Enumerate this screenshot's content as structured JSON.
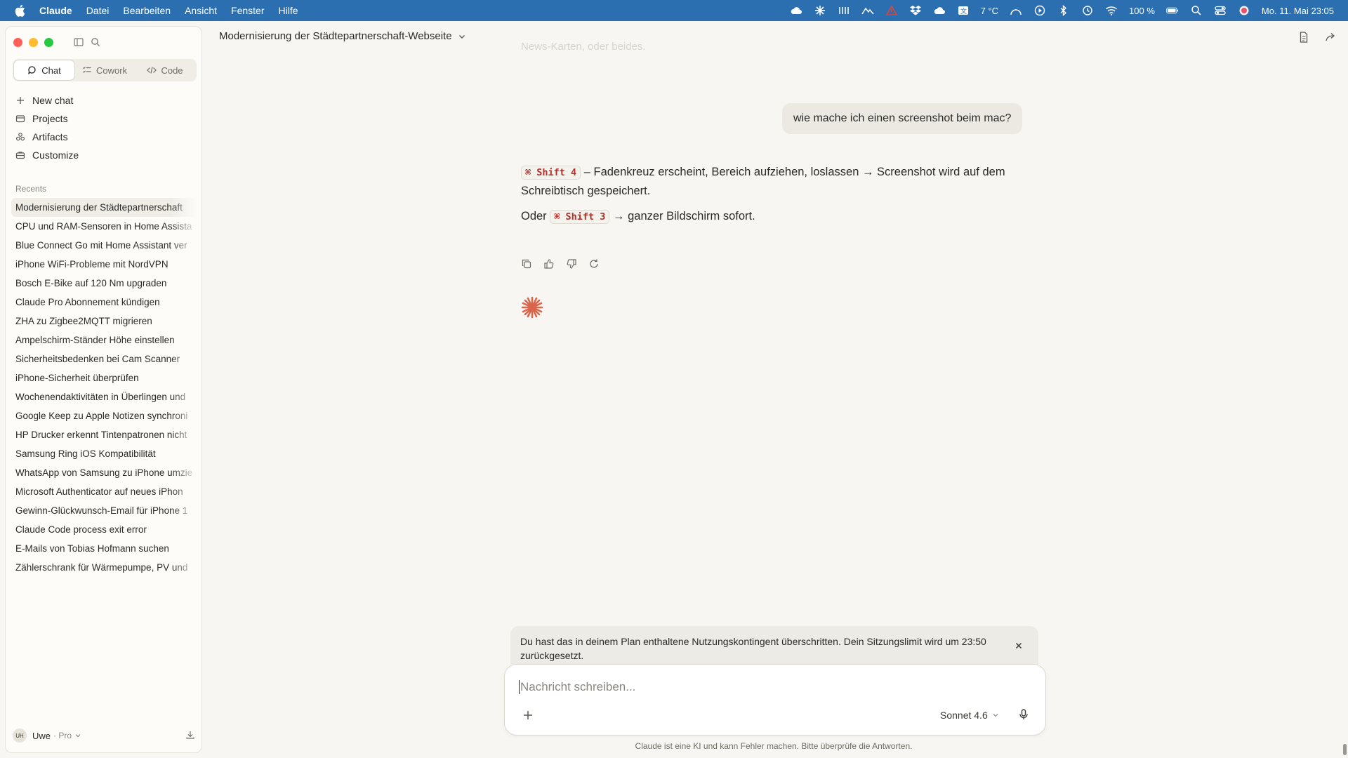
{
  "menubar": {
    "app": "Claude",
    "items": [
      "Datei",
      "Bearbeiten",
      "Ansicht",
      "Fenster",
      "Hilfe"
    ],
    "temperature": "7 °C",
    "battery": "100 %",
    "datetime": "Mo. 11. Mai  23:05"
  },
  "sidebar": {
    "modes": [
      {
        "label": "Chat",
        "icon": "chat-bubble-icon"
      },
      {
        "label": "Cowork",
        "icon": "checklist-icon"
      },
      {
        "label": "Code",
        "icon": "code-icon"
      }
    ],
    "nav": [
      {
        "label": "New chat",
        "icon": "plus-icon"
      },
      {
        "label": "Projects",
        "icon": "folder-icon"
      },
      {
        "label": "Artifacts",
        "icon": "artifacts-icon"
      },
      {
        "label": "Customize",
        "icon": "briefcase-icon"
      }
    ],
    "recents_label": "Recents",
    "recents": [
      "Modernisierung der Städtepartnerschaft",
      "CPU und RAM-Sensoren in Home Assista",
      "Blue Connect Go mit Home Assistant ver",
      "iPhone WiFi-Probleme mit NordVPN",
      "Bosch E-Bike auf 120 Nm upgraden",
      "Claude Pro Abonnement kündigen",
      "ZHA zu Zigbee2MQTT migrieren",
      "Ampelschirm-Ständer Höhe einstellen",
      "Sicherheitsbedenken bei Cam Scanner",
      "iPhone-Sicherheit überprüfen",
      "Wochenendaktivitäten in Überlingen und",
      "Google Keep zu Apple Notizen synchroni",
      "HP Drucker erkennt Tintenpatronen nicht",
      "Samsung Ring iOS Kompatibilität",
      "WhatsApp von Samsung zu iPhone umzie",
      "Microsoft Authenticator auf neues iPhon",
      "Gewinn-Glückwunsch-Email für iPhone 1",
      "Claude Code process exit error",
      "E-Mails von Tobias Hofmann suchen",
      "Zählerschrank für Wärmepumpe, PV und"
    ],
    "user": {
      "initials": "UH",
      "name": "Uwe",
      "plan": "· Pro"
    }
  },
  "conversation": {
    "title": "Modernisierung der Städtepartnerschaft-Webseite",
    "faded_text": "News-Karten, oder beides.",
    "user_message": "wie mache ich einen screenshot beim mac?",
    "assistant": {
      "line1_key": "⌘ Shift 4",
      "line1_text": " – Fadenkreuz erscheint, Bereich aufziehen, loslassen → Screenshot wird auf dem Schreibtisch gespeichert.",
      "line2_prefix": "Oder ",
      "line2_key": "⌘ Shift 3",
      "line2_text": " → ganzer Bildschirm sofort."
    }
  },
  "banner": {
    "text": "Du hast das in deinem Plan enthaltene Nutzungskontingent überschritten. Dein Sitzungslimit wird um 23:50 zurückgesetzt."
  },
  "composer": {
    "placeholder": "Nachricht schreiben...",
    "model": "Sonnet 4.6"
  },
  "disclaimer": "Claude ist eine KI und kann Fehler machen. Bitte überprüfe die Antworten.",
  "colors": {
    "menubar": "#2b6fb0",
    "accent": "#d9654b",
    "background": "#f7f6f2"
  }
}
